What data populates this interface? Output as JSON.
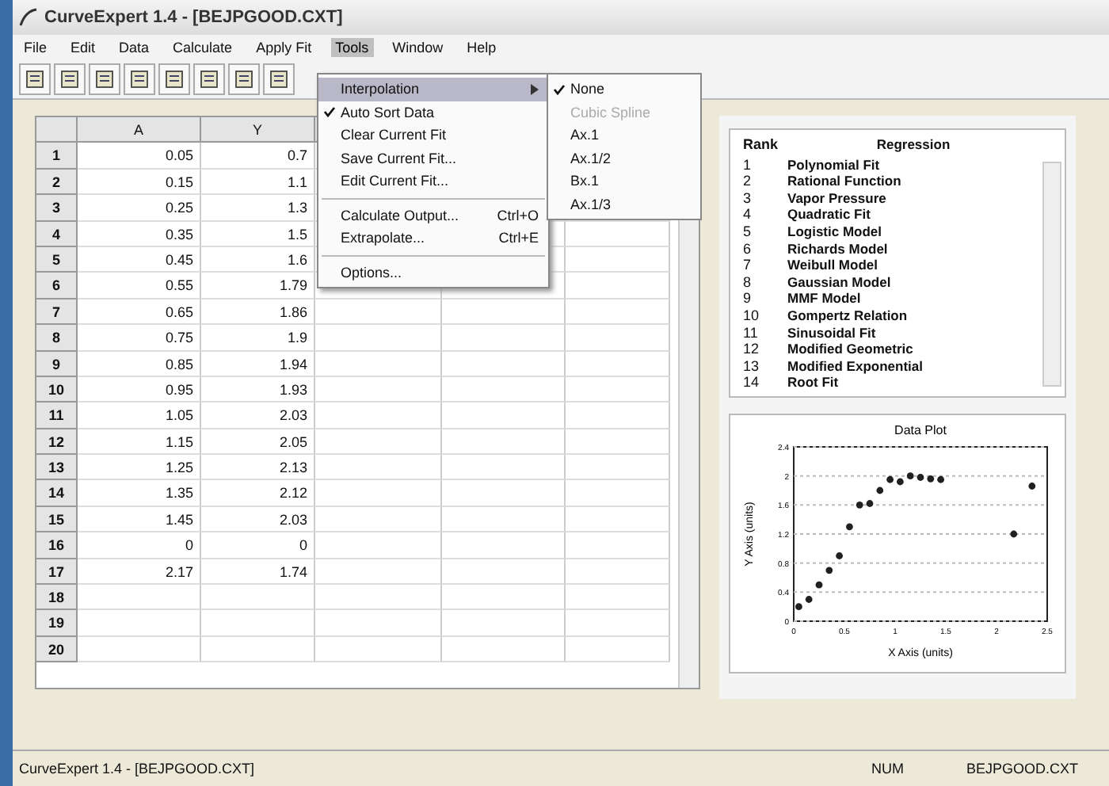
{
  "window": {
    "title": "CurveExpert 1.4 - [BEJPGOOD.CXT]"
  },
  "menu_bar": [
    {
      "label": "File",
      "selected": false
    },
    {
      "label": "Edit",
      "selected": false
    },
    {
      "label": "Data",
      "selected": false
    },
    {
      "label": "Calculate",
      "selected": false
    },
    {
      "label": "Apply Fit",
      "selected": false
    },
    {
      "label": "Tools",
      "selected": true
    },
    {
      "label": "Window",
      "selected": false
    },
    {
      "label": "Help",
      "selected": false
    }
  ],
  "tools_menu": [
    {
      "kind": "submenu",
      "label": "Interpolation",
      "checked": false,
      "selected": true
    },
    {
      "kind": "item",
      "label": "Auto Sort Data",
      "checked": true,
      "selected": false
    },
    {
      "kind": "item",
      "label": "Clear Current Fit",
      "checked": false,
      "selected": false
    },
    {
      "kind": "item",
      "label": "Save Current Fit...",
      "checked": false,
      "selected": false
    },
    {
      "kind": "item",
      "label": "Edit Current Fit...",
      "checked": false,
      "selected": false
    },
    {
      "kind": "separator"
    },
    {
      "kind": "item",
      "label": "Calculate Output...",
      "shortcut": "Ctrl+O",
      "checked": false,
      "selected": false
    },
    {
      "kind": "item",
      "label": "Extrapolate...",
      "shortcut": "Ctrl+E",
      "checked": false,
      "selected": false
    },
    {
      "kind": "separator"
    },
    {
      "kind": "item",
      "label": "Options...",
      "checked": false,
      "selected": false
    }
  ],
  "submenu": [
    {
      "label": "None",
      "checked": true,
      "disabled": false
    },
    {
      "label": "Cubic Spline",
      "checked": false,
      "disabled": true
    },
    {
      "label": "Ax.1",
      "checked": false,
      "disabled": false
    },
    {
      "label": "Ax.1/2",
      "checked": false,
      "disabled": false
    },
    {
      "label": "Bx.1",
      "checked": false,
      "disabled": false
    },
    {
      "label": "Ax.1/3",
      "checked": false,
      "disabled": false
    }
  ],
  "table": {
    "columns": [
      "A",
      "Y"
    ],
    "rows": [
      {
        "row": "1",
        "cells": [
          "0.05",
          "0.7"
        ]
      },
      {
        "row": "2",
        "cells": [
          "0.15",
          "1.1"
        ]
      },
      {
        "row": "3",
        "cells": [
          "0.25",
          "1.3"
        ]
      },
      {
        "row": "4",
        "cells": [
          "0.35",
          "1.5"
        ]
      },
      {
        "row": "5",
        "cells": [
          "0.45",
          "1.6"
        ]
      },
      {
        "row": "6",
        "cells": [
          "0.55",
          "1.79"
        ]
      },
      {
        "row": "7",
        "cells": [
          "0.65",
          "1.86"
        ]
      },
      {
        "row": "8",
        "cells": [
          "0.75",
          "1.9"
        ]
      },
      {
        "row": "9",
        "cells": [
          "0.85",
          "1.94"
        ]
      },
      {
        "row": "10",
        "cells": [
          "0.95",
          "1.93"
        ]
      },
      {
        "row": "11",
        "cells": [
          "1.05",
          "2.03"
        ]
      },
      {
        "row": "12",
        "cells": [
          "1.15",
          "2.05"
        ]
      },
      {
        "row": "13",
        "cells": [
          "1.25",
          "2.13"
        ]
      },
      {
        "row": "14",
        "cells": [
          "1.35",
          "2.12"
        ]
      },
      {
        "row": "15",
        "cells": [
          "1.45",
          "2.03"
        ]
      },
      {
        "row": "16",
        "cells": [
          "0",
          "0"
        ]
      },
      {
        "row": "17",
        "cells": [
          "2.17",
          "1.74"
        ]
      },
      {
        "row": "18",
        "cells": []
      },
      {
        "row": "19",
        "cells": []
      },
      {
        "row": "20",
        "cells": []
      }
    ]
  },
  "ranking": {
    "columns": [
      "Rank",
      "Regression"
    ],
    "rows": [
      [
        "1",
        "Polynomial Fit"
      ],
      [
        "2",
        "Rational Function"
      ],
      [
        "3",
        "Vapor Pressure"
      ],
      [
        "4",
        "Quadratic Fit"
      ],
      [
        "5",
        "Logistic Model"
      ],
      [
        "6",
        "Richards Model"
      ],
      [
        "7",
        "Weibull Model"
      ],
      [
        "8",
        "Gaussian Model"
      ],
      [
        "9",
        "MMF Model"
      ],
      [
        "10",
        "Gompertz Relation"
      ],
      [
        "11",
        "Sinusoidal Fit"
      ],
      [
        "12",
        "Modified Geometric"
      ],
      [
        "13",
        "Modified Exponential"
      ],
      [
        "14",
        "Root Fit"
      ]
    ]
  },
  "plot": {
    "chart_data": {
      "type": "scatter",
      "title": "Data Plot",
      "xlabel": "X Axis (units)",
      "ylabel": "Y Axis (units)",
      "xlim": [
        0,
        2.5
      ],
      "ylim": [
        0,
        2.4
      ],
      "xticks": [
        0,
        0.5,
        1,
        1.5,
        2,
        2.5
      ],
      "yticks": [
        0,
        0.4,
        0.8,
        1.2,
        1.6,
        2,
        2.4
      ],
      "grid": true,
      "series": [
        {
          "color": "#202020",
          "x": [
            0.05,
            0.15,
            0.25,
            0.35,
            0.45,
            0.55,
            0.65,
            0.75,
            0.85,
            0.95,
            1.05,
            1.15,
            1.25,
            1.35,
            1.45,
            2.17,
            2.35
          ],
          "values": [
            0.2,
            0.3,
            0.5,
            0.7,
            0.9,
            1.3,
            1.6,
            1.62,
            1.8,
            1.95,
            1.92,
            2.0,
            1.98,
            1.96,
            1.95,
            1.2,
            1.86
          ]
        }
      ]
    }
  },
  "status_bar": {
    "text": "CurveExpert 1.4 - [BEJPGOOD.CXT]",
    "indicator": "NUM",
    "file": "BEJPGOOD.CXT"
  }
}
